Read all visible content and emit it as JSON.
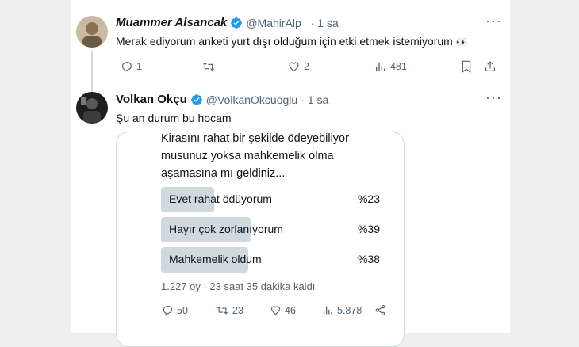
{
  "tweet1": {
    "name": "Muammer Alsancak",
    "handle": "@MahirAlp_",
    "separator": "·",
    "time": "1 sa",
    "text": "Merak ediyorum anketi yurt dışı olduğum için etki etmek istemiyorum",
    "emoji": "👀",
    "actions": {
      "replies": "1",
      "retweets": "",
      "likes": "2",
      "views": "481"
    }
  },
  "tweet2": {
    "name": "Volkan Okçu",
    "handle": "@VolkanOkcuoglu",
    "separator": "·",
    "time": "1 sa",
    "text": "Şu an durum bu hocam",
    "poll": {
      "question_lines": [
        "Kirasını rahat bir şekilde ödeyebiliyor",
        "musunuz yoksa mahkemelik olma",
        "aşamasına mı geldiniz..."
      ],
      "options": [
        {
          "label": "Evet rahat ödüyorum",
          "percent_text": "%23",
          "value": 23
        },
        {
          "label": "Hayır çok zorlanıyorum",
          "percent_text": "%39",
          "value": 39
        },
        {
          "label": "Mahkemelik oldum",
          "percent_text": "%38",
          "value": 38
        }
      ],
      "meta": "1.227 oy · 23 saat 35 dakika kaldı"
    },
    "actions": {
      "replies": "50",
      "retweets": "23",
      "likes": "46",
      "views": "5.878"
    }
  },
  "colors": {
    "verified": "#1d9bf0",
    "muted": "#536471",
    "poll_bar": "#cfd9de",
    "text": "#0f1419"
  },
  "icons": [
    "verified-badge-icon",
    "more-icon",
    "reply-icon",
    "retweet-icon",
    "like-icon",
    "views-icon",
    "bookmark-icon",
    "share-icon"
  ]
}
